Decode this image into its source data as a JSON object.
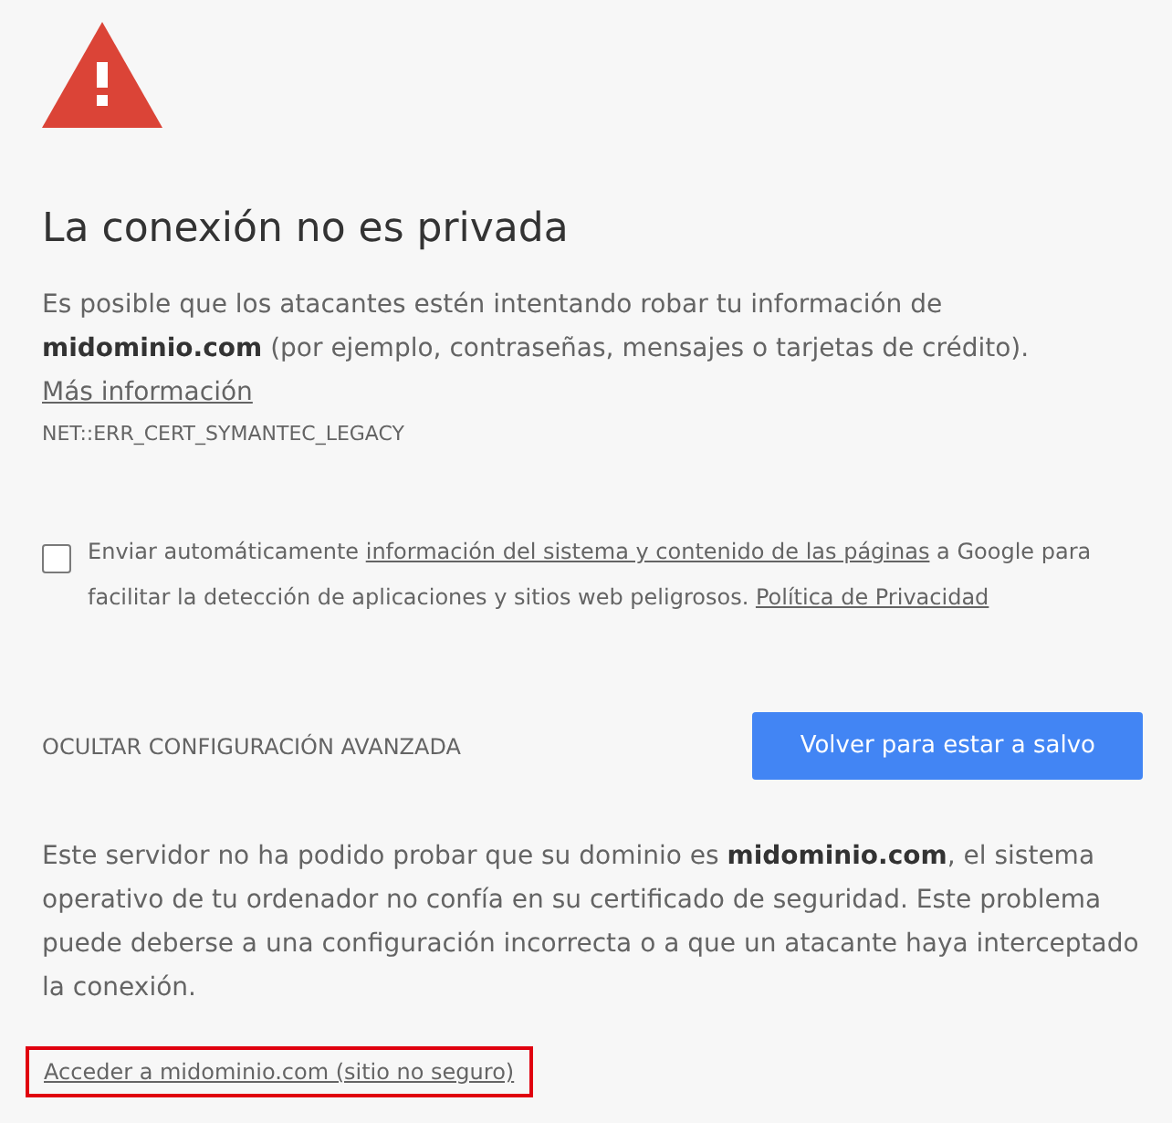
{
  "heading": "La conexión no es privada",
  "intro": {
    "text": "Es posible que los atacantes estén intentando robar tu información de **midominio.com**  (por ejemplo, contraseñas, mensajes o tarjetas de crédito).",
    "link": "Más información"
  },
  "error_code": "NET::ERR_CERT_SYMANTEC_LEGACY",
  "report": {
    "checked": false,
    "segments": [
      {
        "kind": "text",
        "text": "Enviar automáticamente"
      },
      {
        "kind": "link",
        "text": "información del sistema y contenido de las páginas"
      },
      {
        "kind": "text",
        "text": "a Google para facilitar la detección de aplicaciones y sitios web peligrosos."
      },
      {
        "kind": "link",
        "text": "Política de Privacidad"
      }
    ]
  },
  "advanced_toggle": "OCULTAR CONFIGURACIÓN AVANZADA",
  "primary_button": "Volver para estar a salvo",
  "details": "Este servidor no ha podido probar que su dominio es **midominio.com**, el sistema operativo de tu ordenador no confía en su certificado de seguridad. Este problema puede deberse a una configuración incorrecta o a que un atacante haya interceptado la conexión.",
  "proceed_link": {
    "text": "Acceder a midominio.com (sitio no seguro)",
    "highlighted": true
  }
}
